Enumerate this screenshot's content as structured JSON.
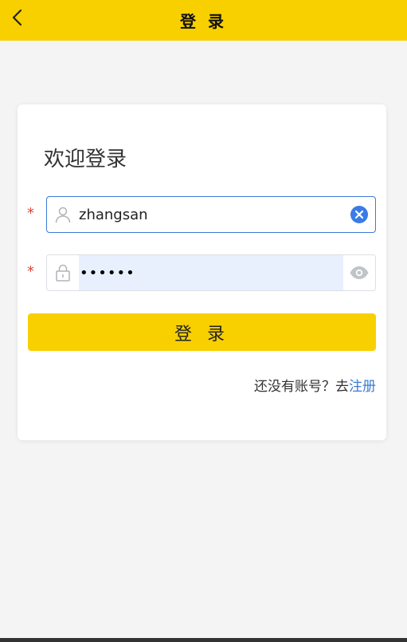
{
  "header": {
    "title": "登 录",
    "back_icon": "chevron-left-icon"
  },
  "card": {
    "welcome": "欢迎登录",
    "required_mark": "*",
    "username": {
      "value": "zhangsan",
      "icon": "user-icon",
      "clear_icon": "clear-icon"
    },
    "password": {
      "value": "••••••",
      "icon": "lock-icon",
      "toggle_icon": "eye-icon"
    },
    "login_button": "登 录",
    "register_prompt": "还没有账号？去",
    "register_link": "注册"
  },
  "colors": {
    "brand": "#f8d000",
    "link": "#3a7bd5",
    "required": "#e0443c"
  }
}
